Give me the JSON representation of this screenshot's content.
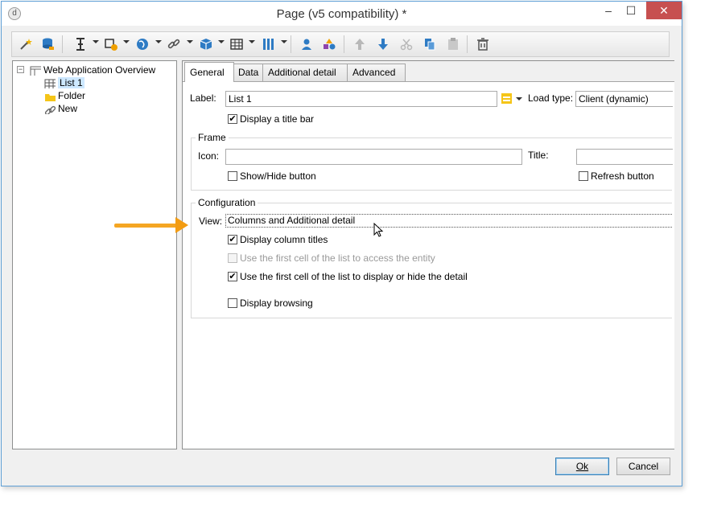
{
  "window": {
    "title": "Page (v5 compatibility) *",
    "app_icon_glyph": "d",
    "minimize_glyph": "–",
    "maximize_glyph": "☐",
    "close_glyph": "✕",
    "accent_color": "#5e9fd5"
  },
  "toolbar": {
    "icons": [
      "wizard-wand-icon",
      "database-export-icon",
      "text-cursor-icon",
      "add-element-icon",
      "globe-icon",
      "link-icon",
      "package-icon",
      "table-icon",
      "columns-icon",
      "user-icon",
      "shapes-icon",
      "move-up-icon",
      "move-down-icon",
      "cut-icon",
      "copy-icon",
      "paste-icon",
      "delete-icon"
    ]
  },
  "tree": {
    "root_label": "Web Application Overview",
    "expander_glyph": "−",
    "items": [
      {
        "label": "List 1",
        "icon": "grid-icon"
      },
      {
        "label": "Folder",
        "icon": "folder-icon"
      },
      {
        "label": "New",
        "icon": "link-icon"
      }
    ]
  },
  "tabs": [
    {
      "label": "General",
      "active": true
    },
    {
      "label": "Data",
      "active": false
    },
    {
      "label": "Additional detail",
      "active": false
    },
    {
      "label": "Advanced",
      "active": false
    }
  ],
  "general": {
    "label_caption": "Label:",
    "label_value": "List 1",
    "load_type_caption": "Load type:",
    "load_type_value": "Client (dynamic)",
    "display_title_bar": {
      "label": "Display a title bar",
      "checked": true
    },
    "frame": {
      "title": "Frame",
      "icon_caption": "Icon:",
      "icon_value": "",
      "title_caption": "Title:",
      "title_value": "",
      "show_hide_button": {
        "label": "Show/Hide button",
        "checked": false
      },
      "refresh_button": {
        "label": "Refresh button",
        "checked": false
      }
    },
    "configuration": {
      "title": "Configuration",
      "view_caption": "View:",
      "view_value": "Columns and Additional detail",
      "display_column_titles": {
        "label": "Display column titles",
        "checked": true
      },
      "first_cell_access": {
        "label": "Use the first cell of the list to access the entity",
        "checked": false,
        "disabled": true
      },
      "first_cell_detail": {
        "label": "Use the first cell of the list to display or hide the detail",
        "checked": true
      },
      "display_browsing": {
        "label": "Display browsing",
        "checked": false
      }
    }
  },
  "buttons": {
    "ok": "Ok",
    "cancel": "Cancel"
  },
  "check_glyph": "✔",
  "highlight_arrow_color": "#f39c12"
}
